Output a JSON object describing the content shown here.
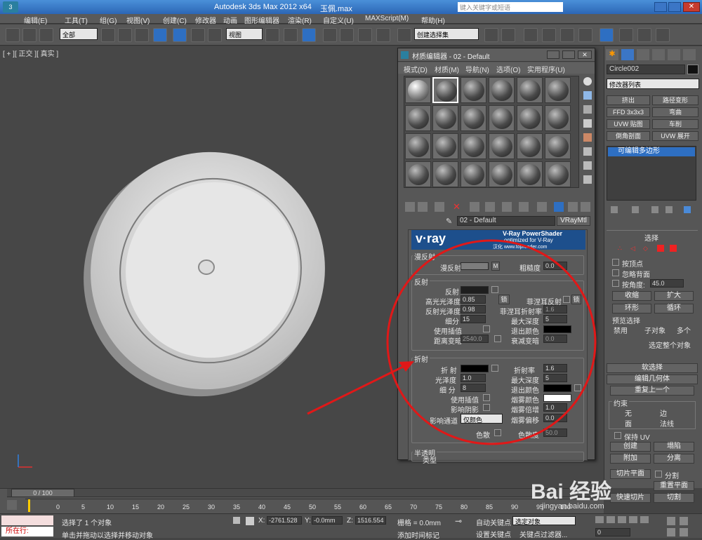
{
  "window": {
    "title": "Autodesk 3ds Max  2012 x64",
    "file": "玉佩.max",
    "search_placeholder": "键入关键字或短语"
  },
  "menu": [
    "编辑(E)",
    "工具(T)",
    "组(G)",
    "视图(V)",
    "创建(C)",
    "修改器",
    "动画",
    "图形编辑器",
    "渲染(R)",
    "自定义(U)",
    "MAXScript(M)",
    "帮助(H)"
  ],
  "toolbar": {
    "filter": "全部",
    "ref_coord": "视图",
    "selection_set": "创建选择集"
  },
  "viewport": {
    "label": "[ + ][ 正交 ][ 真实 ]"
  },
  "mat_editor": {
    "title": "材质编辑器 - 02 - Default",
    "menu": [
      "模式(D)",
      "材质(M)",
      "导航(N)",
      "选项(O)",
      "实用程序(U)"
    ],
    "material_name": "02 - Default",
    "material_type": "VRayMtl",
    "banner": "v·ray",
    "banner_sub1": "V-Ray PowerShader",
    "banner_sub2": "optimized for V-Ray",
    "banner_url": "汉化 www.toprender.com",
    "diffuse": {
      "header": "漫反射",
      "diffuse_label": "漫反射",
      "map_btn": "M",
      "roughness_label": "粗糙度",
      "roughness": "0.0"
    },
    "reflection": {
      "header": "反射",
      "reflect_label": "反射",
      "hilight_gloss_label": "高光光泽度",
      "hilight_gloss": "0.85",
      "lock": "锁",
      "fresnel_label": "菲涅耳反射",
      "refl_gloss_label": "反射光泽度",
      "refl_gloss": "0.98",
      "fresnel_ior_label": "菲涅耳折射率",
      "fresnel_ior": "1.6",
      "fresnel_lock": "锁",
      "subdivs_label": "细分",
      "subdivs": "15",
      "max_depth_label": "最大深度",
      "max_depth": "5",
      "use_interp_label": "使用插值",
      "exit_color_label": "退出颜色",
      "dim_dist_label": "距离变暗",
      "dim_dist": "2540.0",
      "dim_falloff_label": "衰减变暗",
      "dim_falloff": "0.0"
    },
    "refraction": {
      "header": "折射",
      "refract_label": "折 射",
      "ior_label": "折射率",
      "ior": "1.6",
      "gloss_label": "光泽度",
      "gloss": "1.0",
      "max_depth_label": "最大深度",
      "max_depth": "5",
      "subdivs_label": "细 分",
      "subdivs": "8",
      "exit_color_label": "退出颜色",
      "use_interp_label": "使用插值",
      "fog_color_label": "烟雾颜色",
      "affect_shadows_label": "影响阴影",
      "fog_mult_label": "烟雾倍增",
      "fog_mult": "1.0",
      "affect_channels_label": "影响通道",
      "affect_channels": "仅颜色",
      "fog_bias_label": "烟雾偏移",
      "fog_bias": "0.0",
      "dispersion_label": "色散",
      "abbe_label": "色散度",
      "abbe": "50.0"
    },
    "translucency": {
      "header": "半透明",
      "type_label": "类型"
    }
  },
  "cmd": {
    "object_name": "Circle002",
    "modifier_list": "修改器列表",
    "mod_buttons": [
      "挤出",
      "路径变形",
      "FFD 3x3x3",
      "弯曲",
      "UVW 贴图",
      "车削",
      "倒角剖面",
      "UVW 展开"
    ],
    "stack_item": "可编辑多边形",
    "selection": {
      "header": "选择",
      "by_vertex": "按顶点",
      "ignore_back": "忽略背面",
      "by_angle": "按角度:",
      "angle": "45.0",
      "shrink": "收缩",
      "grow": "扩大",
      "ring": "环形",
      "loop": "循环",
      "preview": "预览选择",
      "off": "禁用",
      "subobj": "子对象",
      "multi": "多个",
      "select_all": "选定整个对象"
    },
    "soft_sel": "软选择",
    "edit_geom": "编辑几何体",
    "repeat_last": "重复上一个",
    "constraints": {
      "header": "约束",
      "none": "无",
      "edge": "边",
      "face": "面",
      "normal": "法线"
    },
    "preserve_uv": "保持 UV",
    "create": "创建",
    "collapse": "塌陷",
    "attach": "附加",
    "detach": "分离",
    "slice_plane": "切片平面",
    "split": "分割",
    "reset_plane": "重置平面",
    "quickslice": "快速切片",
    "cut": "切割"
  },
  "timeline": {
    "frame": "0 / 100",
    "ticks": [
      "0",
      "5",
      "10",
      "15",
      "20",
      "25",
      "30",
      "35",
      "40",
      "45",
      "50",
      "55",
      "60",
      "65",
      "70",
      "75",
      "80",
      "85",
      "90",
      "95",
      "100"
    ]
  },
  "status": {
    "maxscript": "所在行:",
    "selected": "选择了 1 个对象",
    "hint": "单击并拖动以选择并移动对象",
    "x_label": "X:",
    "x": "-2761.528",
    "y_label": "Y:",
    "y": "-0.0mm",
    "z_label": "Z:",
    "z": "1516.554",
    "grid": "栅格 = 0.0mm",
    "autokey": "自动关键点",
    "set_key": "设置关键点",
    "sel_set": "选定对象",
    "key_filters": "关键点过滤器...",
    "add_time_tag": "添加时间标记",
    "frame_field": "0"
  },
  "watermark": "Bai 经验",
  "watermark_url": "jingyan.baidu.com"
}
